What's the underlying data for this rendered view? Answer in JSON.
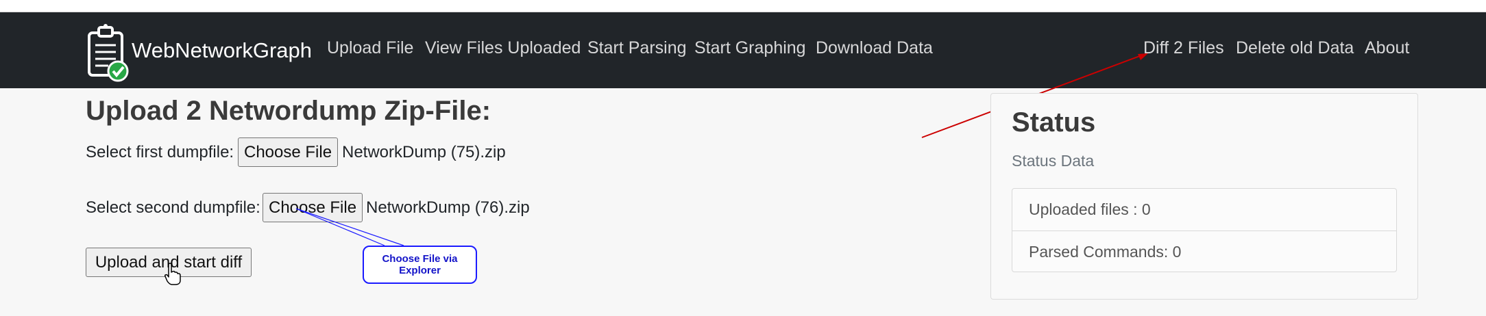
{
  "navbar": {
    "brand": "WebNetworkGraph",
    "links": [
      "Upload File",
      "View Files Uploaded",
      "Start Parsing",
      "Start Graphing",
      "Download Data",
      "Diff 2 Files",
      "Delete old Data",
      "About"
    ]
  },
  "form": {
    "title": "Upload 2 Networdump Zip-File:",
    "first_label": "Select first dumpfile:",
    "second_label": "Select second dumpfile:",
    "choose_file_label": "Choose File",
    "first_file": "NetworkDump (75).zip",
    "second_file": "NetworkDump (76).zip",
    "submit_label": "Upload and start diff"
  },
  "annotation": {
    "callout_line1": "Choose File via",
    "callout_line2": "Explorer"
  },
  "status": {
    "title": "Status",
    "subtitle": "Status Data",
    "items": [
      "Uploaded files : 0",
      "Parsed Commands: 0"
    ]
  },
  "colors": {
    "navbar_bg": "#212529",
    "arrow": "#cc0000",
    "callout": "#1a1aff",
    "check": "#28a745"
  },
  "icons": {
    "brand": "clipboard-check-icon",
    "cursor": "hand-pointer-icon"
  }
}
